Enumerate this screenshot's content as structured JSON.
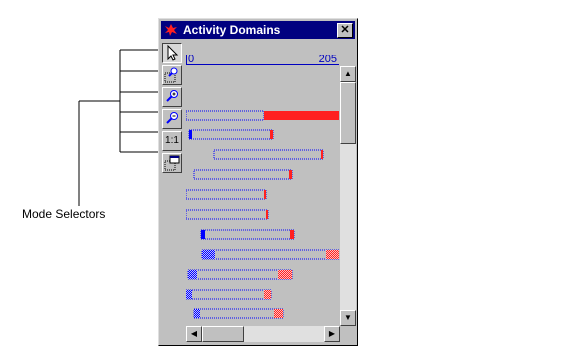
{
  "callout": {
    "label": "Mode Selectors"
  },
  "window": {
    "title": "Activity Domains",
    "close_label": "✕"
  },
  "toolbar": {
    "buttons": [
      {
        "id": "select",
        "icon": "arrow-cursor-icon"
      },
      {
        "id": "zoom-box",
        "icon": "zoom-box-icon"
      },
      {
        "id": "zoom-in",
        "icon": "zoom-in-icon"
      },
      {
        "id": "zoom-out",
        "icon": "zoom-out-icon"
      },
      {
        "id": "one-to-one",
        "label": "1:1"
      },
      {
        "id": "fit-window",
        "icon": "fit-window-icon"
      }
    ]
  },
  "scale": {
    "min": "0",
    "max": "205"
  },
  "colors": {
    "blue": "#0000ff",
    "red": "#ff2020",
    "scale": "#0000c0",
    "title_bar": "#000080"
  }
}
